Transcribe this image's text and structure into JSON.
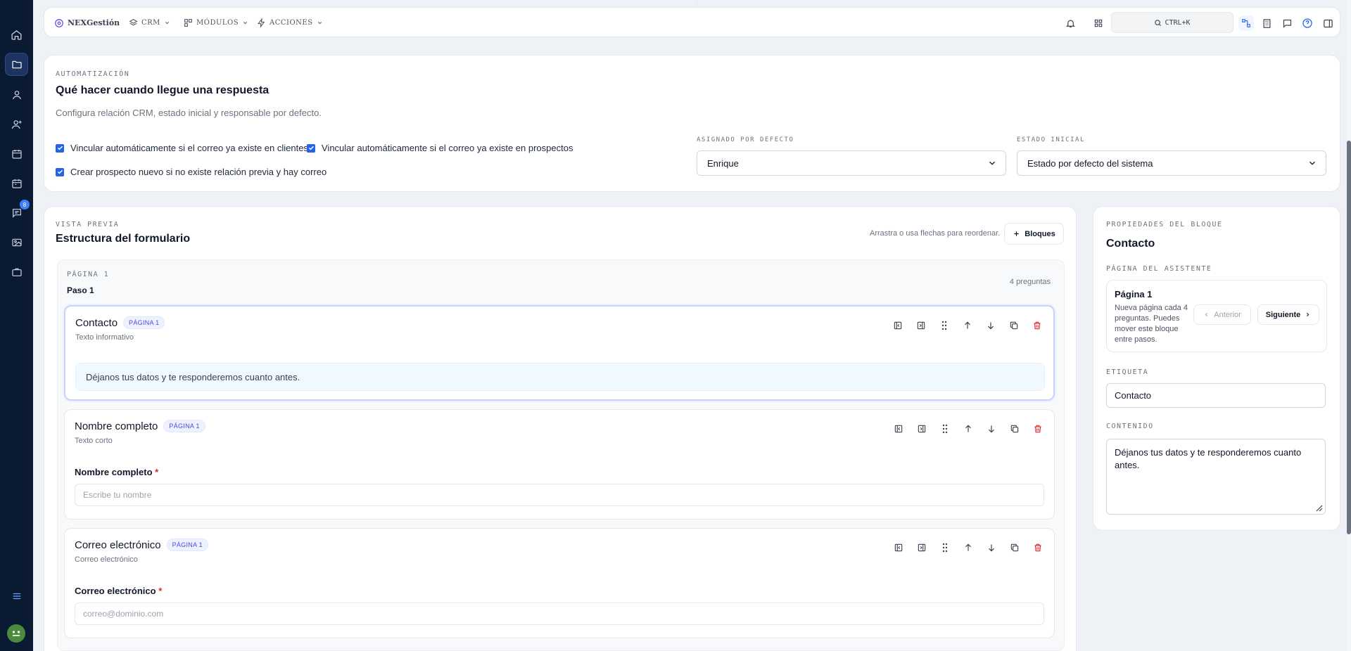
{
  "topbar": {
    "brand": "NEXGestión",
    "menus": [
      {
        "label": "CRM"
      },
      {
        "label": "MÓDULOS"
      },
      {
        "label": "ACCIONES"
      }
    ],
    "search_shortcut": "CTRL+K"
  },
  "rail": {
    "messages_badge": "8"
  },
  "automation": {
    "eyebrow": "AUTOMATIZACIÓN",
    "title": "Qué hacer cuando llegue una respuesta",
    "description": "Configura relación CRM, estado inicial y responsable por defecto.",
    "checks": [
      {
        "label": "Vincular automáticamente si el correo ya existe en clientes",
        "checked": true
      },
      {
        "label": "Vincular automáticamente si el correo ya existe en prospectos",
        "checked": true
      },
      {
        "label": "Crear prospecto nuevo si no existe relación previa y hay correo",
        "checked": true
      }
    ],
    "assigned": {
      "label": "ASIGNADO POR DEFECTO",
      "value": "Enrique"
    },
    "initial_state": {
      "label": "ESTADO INICIAL",
      "value": "Estado por defecto del sistema"
    }
  },
  "preview": {
    "eyebrow": "VISTA PREVIA",
    "title": "Estructura del formulario",
    "hint": "Arrastra o usa flechas para reordenar.",
    "blocks_button": "Bloques",
    "page": {
      "label": "PÁGINA 1",
      "step": "Paso 1",
      "count": "4 preguntas"
    },
    "blocks": [
      {
        "title": "Contacto",
        "badge": "PÁGINA 1",
        "type": "Texto informativo",
        "content": "Déjanos tus datos y te responderemos cuanto antes."
      },
      {
        "title": "Nombre completo",
        "badge": "PÁGINA 1",
        "type": "Texto corto",
        "field_label": "Nombre completo",
        "required_mark": "*",
        "placeholder": "Escribe tu nombre"
      },
      {
        "title": "Correo electrónico",
        "badge": "PÁGINA 1",
        "type": "Correo electrónico",
        "field_label": "Correo electrónico",
        "required_mark": "*",
        "placeholder": "correo@dominio.com"
      }
    ]
  },
  "properties": {
    "eyebrow": "PROPIEDADES DEL BLOQUE",
    "title": "Contacto",
    "wizard_label": "PÁGINA DEL ASISTENTE",
    "wizard_page": "Página 1",
    "wizard_help": "Nueva página cada 4 preguntas. Puedes mover este bloque entre pasos.",
    "prev_button": "Anterior",
    "next_button": "Siguiente",
    "tag_label": "ETIQUETA",
    "tag_value": "Contacto",
    "content_label": "CONTENIDO",
    "content_value": "Déjanos tus datos y te responderemos cuanto antes."
  }
}
